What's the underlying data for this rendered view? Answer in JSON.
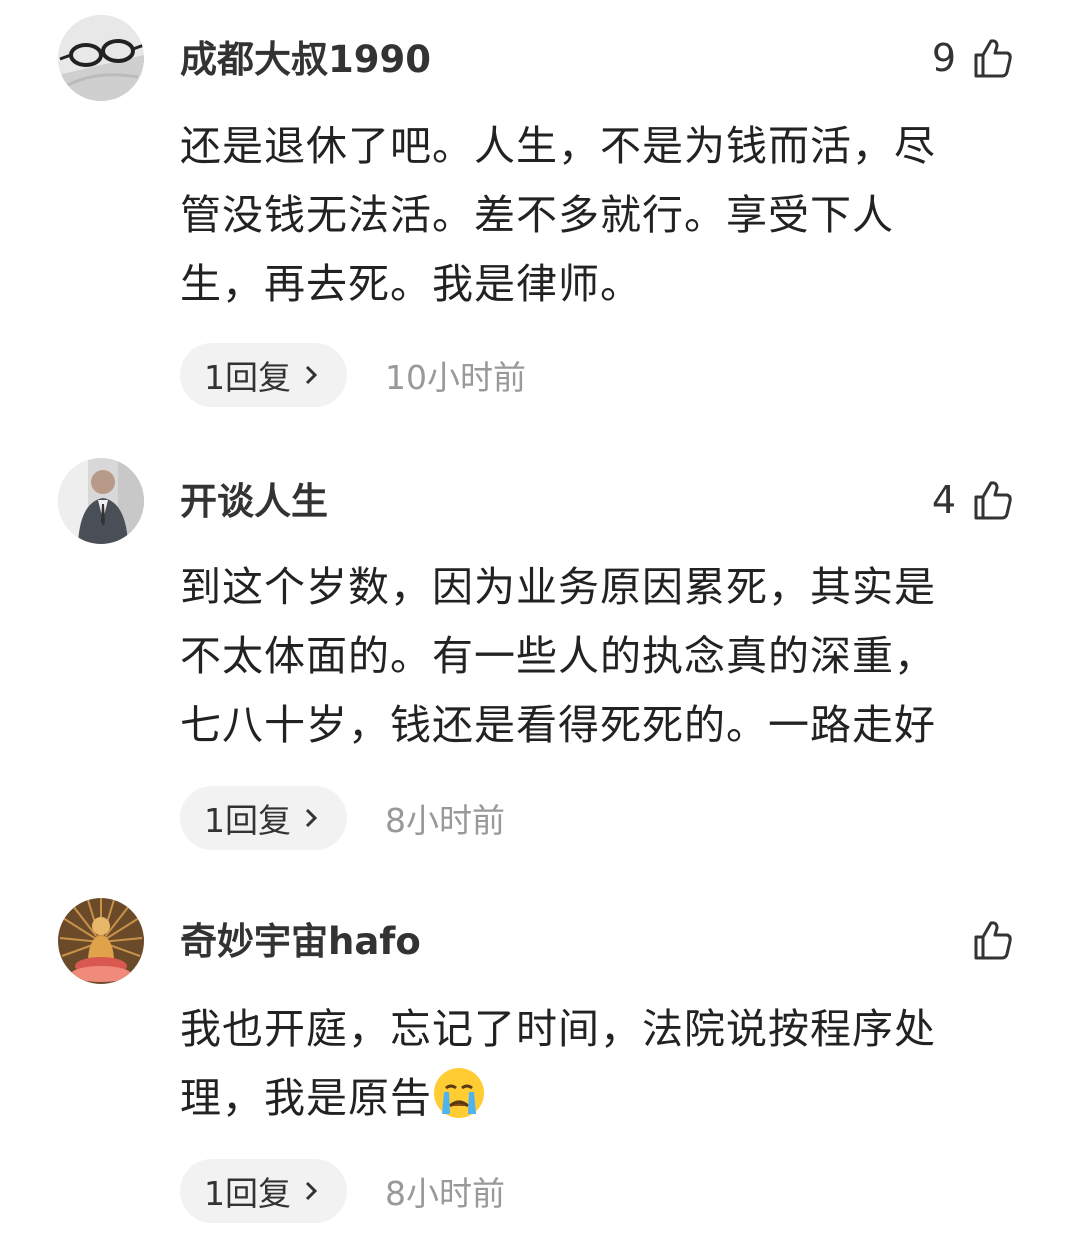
{
  "comments": [
    {
      "username": "成都大叔1990",
      "like_count": "9",
      "lines": [
        "还是退休了吧。人生，不是为钱而活，尽",
        "管没钱无法活。差不多就行。享受下人",
        "生，再去死。我是律师。"
      ],
      "reply_label": "1回复",
      "time": "10小时前",
      "avatar_icon": "glasses-avatar"
    },
    {
      "username": "开谈人生",
      "like_count": "4",
      "lines": [
        "到这个岁数，因为业务原因累死，其实是",
        "不太体面的。有一些人的执念真的深重，",
        "七八十岁，钱还是看得死死的。一路走好"
      ],
      "reply_label": "1回复",
      "time": "8小时前",
      "avatar_icon": "man-in-suit-avatar"
    },
    {
      "username": "奇妙宇宙hafo",
      "like_count": "",
      "lines": [
        "我也开庭，忘记了时间，法院说按程序处",
        "理，我是原告"
      ],
      "emoji": "crying-face-emoji",
      "reply_label": "1回复",
      "time": "8小时前",
      "avatar_icon": "thousand-armed-buddha-avatar"
    }
  ],
  "icons": {
    "like": "thumbs-up-icon",
    "chevron": "chevron-right-icon"
  },
  "colors": {
    "text": "#222222",
    "secondary": "#999999",
    "pill_bg": "#f2f2f2"
  }
}
